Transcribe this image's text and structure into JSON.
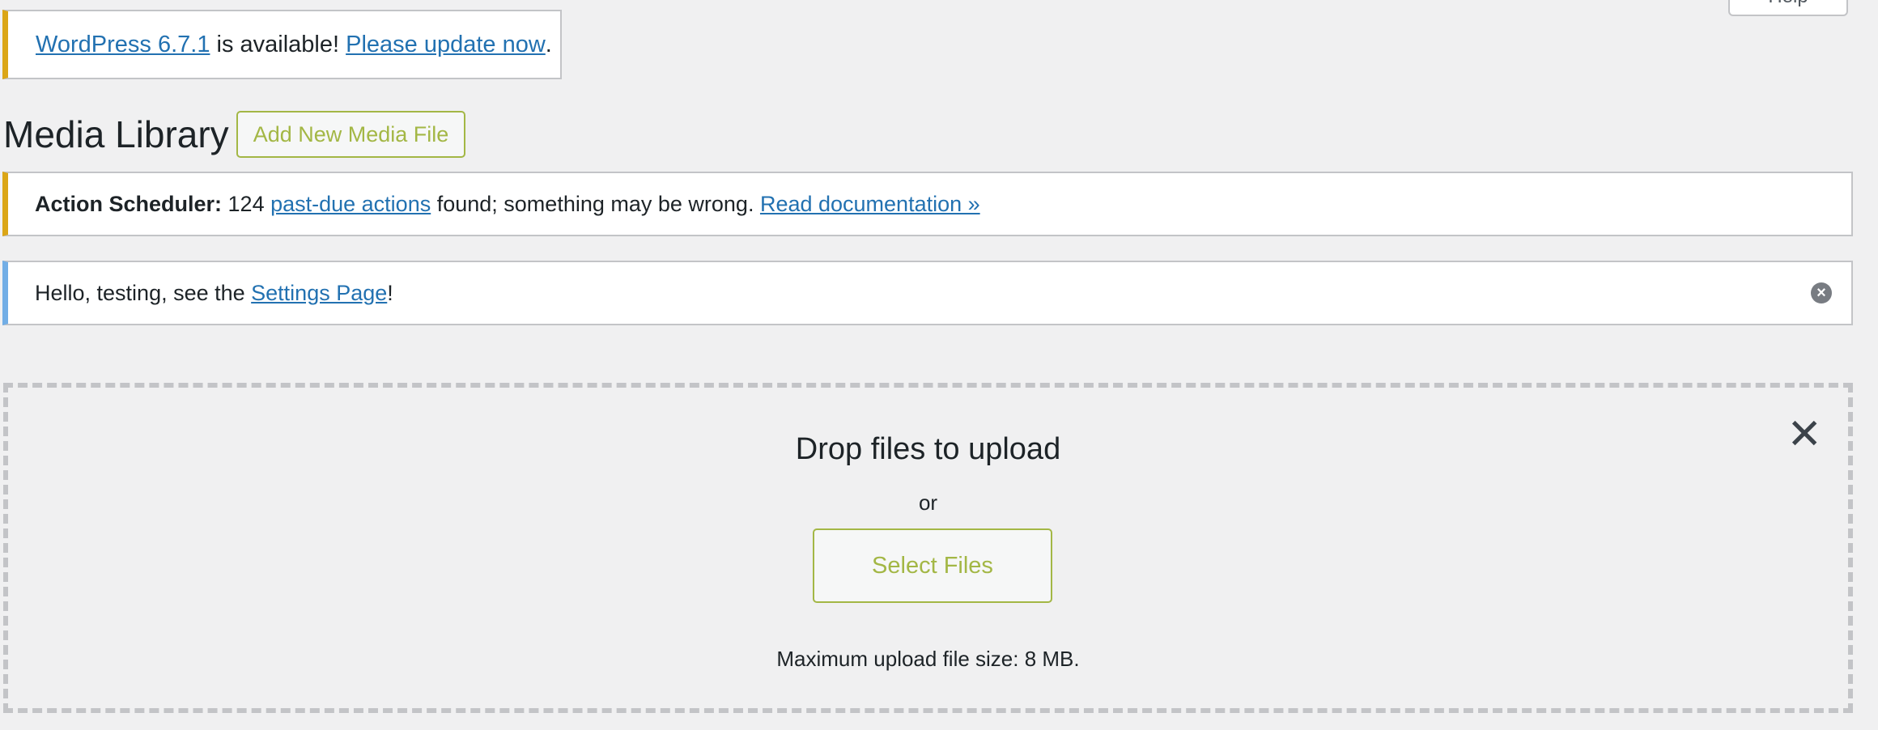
{
  "help_tab": {
    "label": "Help"
  },
  "update_notice": {
    "version_link": "WordPress 6.7.1",
    "text": " is available! ",
    "update_link": "Please update now",
    "end": "."
  },
  "header": {
    "title": "Media Library",
    "add_new_label": "Add New Media File"
  },
  "scheduler_notice": {
    "label": "Action Scheduler:",
    "count": " 124 ",
    "link": "past-due actions",
    "text": " found; something may be wrong. ",
    "doc_link": "Read documentation »"
  },
  "hello_notice": {
    "text": "Hello, testing, see the ",
    "link": "Settings Page",
    "end": "!",
    "dismiss_glyph": "×"
  },
  "uploader": {
    "close_glyph": "✕",
    "title": "Drop files to upload",
    "or": "or",
    "select_label": "Select Files",
    "max_size": "Maximum upload file size: 8 MB."
  },
  "colors": {
    "accent": "#a3b745",
    "link": "#2271b1",
    "warning": "#dba617",
    "info": "#72aee6"
  }
}
